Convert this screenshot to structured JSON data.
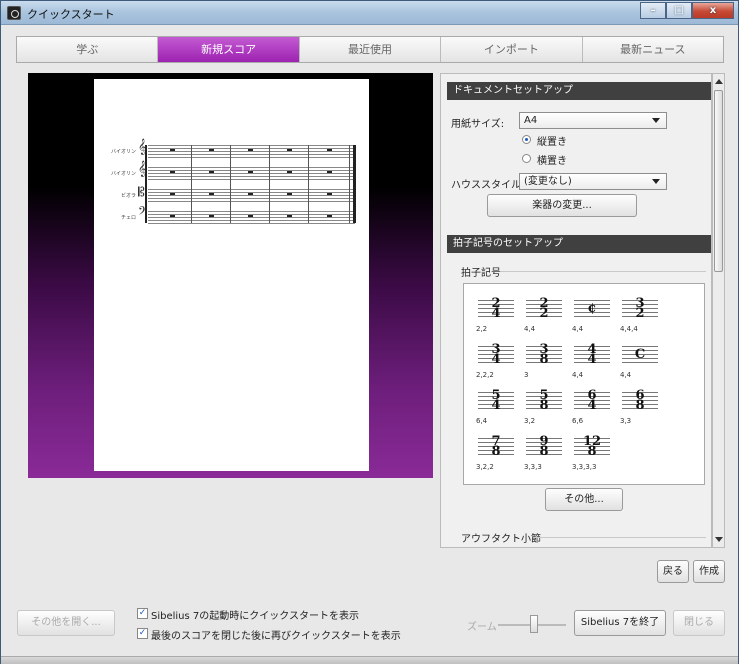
{
  "window": {
    "title": "クイックスタート"
  },
  "tabs": [
    {
      "label": "学ぶ",
      "active": false
    },
    {
      "label": "新規スコア",
      "active": true
    },
    {
      "label": "最近使用",
      "active": false
    },
    {
      "label": "インポート",
      "active": false
    },
    {
      "label": "最新ニュース",
      "active": false
    }
  ],
  "preview": {
    "instruments": [
      "バイオリン",
      "バイオリン",
      "ビオラ",
      "チェロ"
    ]
  },
  "document_setup": {
    "header": "ドキュメントセットアップ",
    "paper_size_label": "用紙サイズ:",
    "paper_size_value": "A4",
    "orientation_portrait": "縦置き",
    "orientation_landscape": "横置き",
    "house_style_label": "ハウススタイル",
    "house_style_value": "(変更なし)",
    "change_instruments_button": "楽器の変更..."
  },
  "time_signature_setup": {
    "header": "拍子記号のセットアップ",
    "group_label": "拍子記号",
    "items": [
      {
        "top": "2",
        "bottom": "4",
        "caption": "2,2"
      },
      {
        "top": "2",
        "bottom": "2",
        "caption": "4,4"
      },
      {
        "symbol": "¢",
        "caption": "4,4"
      },
      {
        "top": "3",
        "bottom": "2",
        "caption": "4,4,4"
      },
      {
        "top": "3",
        "bottom": "4",
        "caption": "2,2,2"
      },
      {
        "top": "3",
        "bottom": "8",
        "caption": "3"
      },
      {
        "top": "4",
        "bottom": "4",
        "caption": "4,4"
      },
      {
        "symbol": "C",
        "caption": "4,4"
      },
      {
        "top": "5",
        "bottom": "4",
        "caption": "6,4"
      },
      {
        "top": "5",
        "bottom": "8",
        "caption": "3,2"
      },
      {
        "top": "6",
        "bottom": "4",
        "caption": "6,6"
      },
      {
        "top": "6",
        "bottom": "8",
        "caption": "3,3"
      },
      {
        "top": "7",
        "bottom": "8",
        "caption": "3,2,2"
      },
      {
        "top": "9",
        "bottom": "8",
        "caption": "3,3,3"
      },
      {
        "top": "12",
        "bottom": "8",
        "caption": "3,3,3,3"
      }
    ],
    "other_button": "その他..."
  },
  "pickup_bar": {
    "group_label": "アウフタクト小節"
  },
  "actions": {
    "back_button": "戻る",
    "create_button": "作成"
  },
  "footer": {
    "open_other_button": "その他を開く...",
    "show_on_startup": "Sibelius 7の起動時にクイックスタートを表示",
    "show_after_close": "最後のスコアを閉じた後に再びクイックスタートを表示",
    "zoom_label": "ズーム",
    "quit_button": "Sibelius 7を終了",
    "close_button": "閉じる"
  }
}
